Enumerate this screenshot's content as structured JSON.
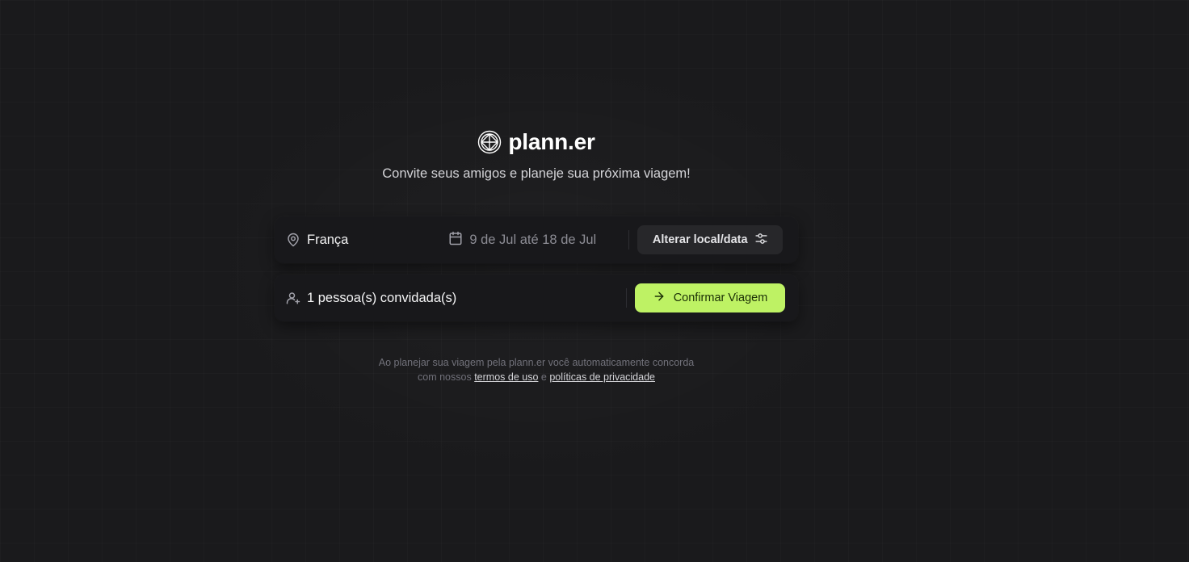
{
  "brand": {
    "name": "plann.er",
    "tagline": "Convite seus amigos e planeje sua próxima viagem!"
  },
  "location_card": {
    "location": "França",
    "dates": "9 de Jul até 18 de Jul",
    "change_button": "Alterar local/data"
  },
  "guests_card": {
    "guests": "1 pessoa(s) convidada(s)",
    "confirm_button": "Confirmar Viagem"
  },
  "footer": {
    "line1": "Ao planejar sua viagem pela plann.er você automaticamente concorda",
    "line2_prefix": "com nossos",
    "terms_link": "termos de uso",
    "connector": "e",
    "privacy_link": "políticas de privacidade"
  },
  "colors": {
    "background": "#1a1a1c",
    "card": "#18181b",
    "accent": "#bef264",
    "secondary_button": "#27272a"
  },
  "icons": {
    "logo": "globe-logo-icon",
    "location": "map-pin-icon",
    "date": "calendar-icon",
    "settings": "settings-sliders-icon",
    "guests": "user-plus-icon",
    "confirm": "arrow-right-icon"
  }
}
